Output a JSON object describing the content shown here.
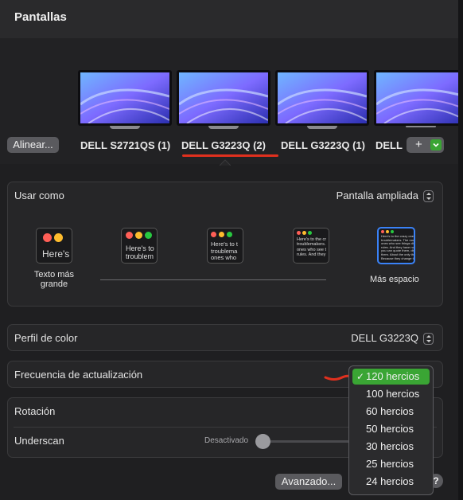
{
  "window": {
    "title": "Pantallas"
  },
  "displays": [
    {
      "label": "DELL S2721QS (1)"
    },
    {
      "label": "DELL G3223Q (2)",
      "selected": true
    },
    {
      "label": "DELL G3223Q (1)"
    },
    {
      "label": "DELL"
    }
  ],
  "align_button": "Alinear...",
  "add_button": "+",
  "add_menu_icon": "chevron-down-icon",
  "use_as": {
    "label": "Usar como",
    "value": "Pantalla ampliada"
  },
  "resolution": {
    "options": [
      {
        "text": "Here's",
        "caption": "Texto más grande"
      },
      {
        "text": "Here's to\ntroublem"
      },
      {
        "text": "Here's to t\ntroublema\nones who"
      },
      {
        "text": "Here's to the cr\ntroublemakers.\nones who see t\nrules. And they"
      },
      {
        "text": "Here's to the crazy one\ntroublemakers. The rou\nones who see things diff\nrules. And they have no\nyou can quote them, dis\nthem. About the only thi\nBecause they change th",
        "caption": "Más espacio"
      }
    ],
    "selected_index": 4,
    "colors": {
      "red": "#ff5f57",
      "yellow": "#febc2e",
      "green": "#28c840",
      "selected_border": "#3a82f7"
    }
  },
  "color_profile": {
    "label": "Perfil de color",
    "value": "DELL G3223Q"
  },
  "refresh_rate": {
    "label": "Frecuencia de actualización",
    "options": [
      "120 hercios",
      "100 hercios",
      "60 hercios",
      "50 hercios",
      "30 hercios",
      "25 hercios",
      "24 hercios"
    ],
    "selected": "120 hercios",
    "check": "✓"
  },
  "rotation": {
    "label": "Rotación"
  },
  "underscan": {
    "label": "Underscan",
    "slider_min_label": "Desactivado",
    "value": 0
  },
  "advanced_button": "Avanzado...",
  "help_button": "?",
  "accent_colors": {
    "selection_red": "#e0301e",
    "menu_highlight": "#3aa534"
  }
}
